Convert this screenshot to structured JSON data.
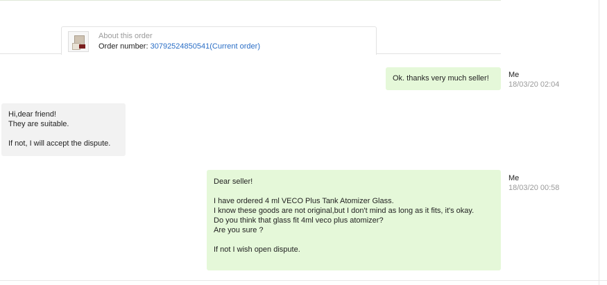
{
  "order": {
    "about_label": "About this order",
    "number_label": "Order number:",
    "number_link": "30792524850541(Current order)"
  },
  "messages": [
    {
      "sender": "Me",
      "time": "18/03/20 02:04",
      "lines": [
        "Ok. thanks very much seller!"
      ]
    },
    {
      "sender": "",
      "time": "",
      "lines": [
        "Hi,dear friend!",
        "They are suitable.",
        "",
        "If not, I will accept the dispute."
      ]
    },
    {
      "sender": "Me",
      "time": "18/03/20 00:58",
      "lines": [
        "Dear seller!",
        "",
        "I have ordered 4 ml VECO Plus Tank Atomizer Glass.",
        "I know these goods are not original,but I don't mind as long as it fits, it's okay.",
        "Do you think that glass fit 4ml veco plus atomizer?",
        "Are you sure ?",
        "",
        "If not I wish open dispute."
      ]
    }
  ]
}
